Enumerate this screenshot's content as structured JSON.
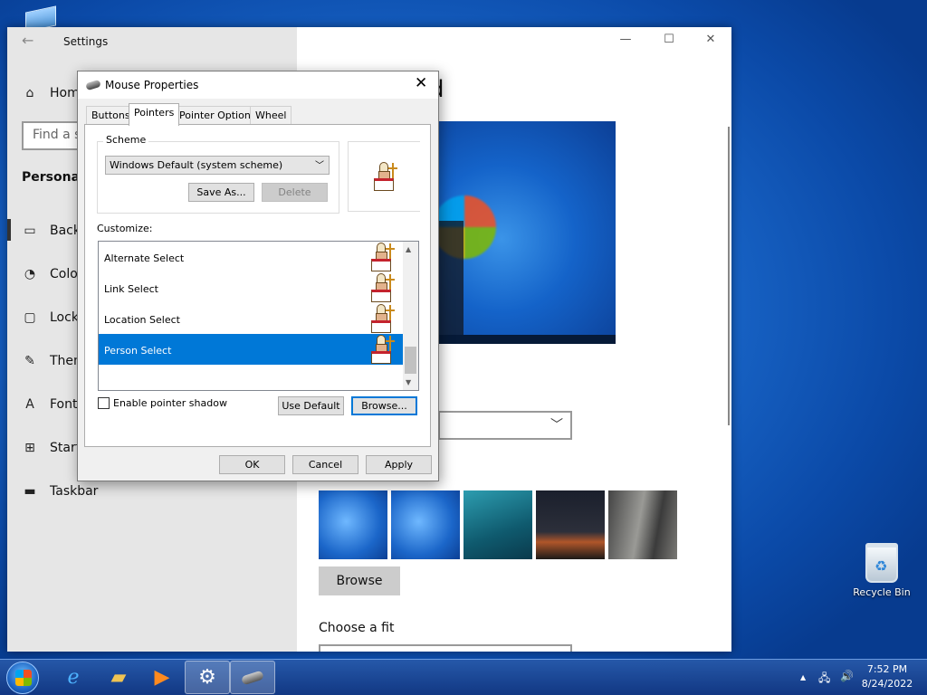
{
  "settings": {
    "title": "Settings",
    "search_placeholder": "Find a se",
    "section": "Personaliz",
    "nav": [
      {
        "label": "Hom",
        "icon": "home-icon"
      },
      {
        "label": "Backg",
        "icon": "image-icon"
      },
      {
        "label": "Color",
        "icon": "palette-icon"
      },
      {
        "label": "Lock",
        "icon": "lock-screen-icon"
      },
      {
        "label": "Them",
        "icon": "themes-icon"
      },
      {
        "label": "Fonts",
        "icon": "fonts-icon"
      },
      {
        "label": "Start",
        "icon": "start-icon"
      },
      {
        "label": "Taskbar",
        "icon": "taskbar-icon"
      }
    ],
    "heading_fragment": "d",
    "browse_label": "Browse",
    "choose_fit": "Choose a fit"
  },
  "dialog": {
    "title": "Mouse Properties",
    "tabs": [
      "Buttons",
      "Pointers",
      "Pointer Options",
      "Wheel"
    ],
    "active_tab": "Pointers",
    "scheme_label": "Scheme",
    "scheme_value": "Windows Default (system scheme)",
    "save_as": "Save As...",
    "delete": "Delete",
    "customize_label": "Customize:",
    "pointers": [
      "Alternate Select",
      "Link Select",
      "Location Select",
      "Person Select"
    ],
    "selected_pointer": "Person Select",
    "enable_shadow": "Enable pointer shadow",
    "enable_shadow_checked": false,
    "use_default": "Use Default",
    "browse": "Browse...",
    "ok": "OK",
    "cancel": "Cancel",
    "apply": "Apply"
  },
  "desktop": {
    "recycle_bin": "Recycle Bin"
  },
  "taskbar": {
    "apps": [
      "internet-explorer-icon",
      "file-explorer-icon",
      "media-player-icon",
      "settings-gear-icon",
      "mouse-icon"
    ],
    "time": "7:52 PM",
    "date": "8/24/2022"
  },
  "colors": {
    "selection": "#0078d7",
    "taskbar": "#1f4f9c"
  }
}
